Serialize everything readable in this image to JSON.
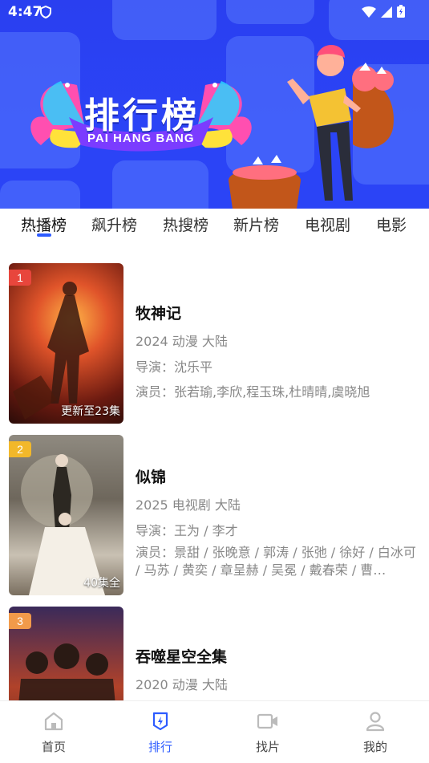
{
  "status_bar": {
    "time": "4:47"
  },
  "banner": {
    "title": "排行榜",
    "subtitle": "PAI HANG BANG"
  },
  "tabs": [
    "热播榜",
    "飙升榜",
    "热搜榜",
    "新片榜",
    "电视剧",
    "电影"
  ],
  "active_tab": 0,
  "items": [
    {
      "rank": "1",
      "title": "牧神记",
      "meta": "2024 动漫 大陆",
      "director": "导演：沈乐平",
      "cast": "演员：张若瑜,李欣,程玉珠,杜晴晴,虞晓旭",
      "episodes": "更新至23集",
      "rank_color": "#e8463c"
    },
    {
      "rank": "2",
      "title": "似锦",
      "meta": "2025 电视剧 大陆",
      "director": "导演：王为 / 李才",
      "cast": "演员：景甜 / 张晚意 / 郭涛 / 张弛 / 徐好 / 白冰可 / 马苏 / 黄奕 / 章呈赫 / 吴冕 / 戴春荣 / 曹…",
      "episodes": "40集全",
      "rank_color": "#f2b82a"
    },
    {
      "rank": "3",
      "title": "吞噬星空全集",
      "meta": "2020 动漫 大陆",
      "rank_color": "#f29a4a"
    }
  ],
  "bottom_nav": [
    {
      "label": "首页",
      "icon": "home-icon"
    },
    {
      "label": "排行",
      "icon": "ranking-icon"
    },
    {
      "label": "找片",
      "icon": "video-camera-icon"
    },
    {
      "label": "我的",
      "icon": "profile-icon"
    }
  ],
  "colors": {
    "accent": "#2d5bff",
    "banner_bg": "#2b44f6"
  }
}
